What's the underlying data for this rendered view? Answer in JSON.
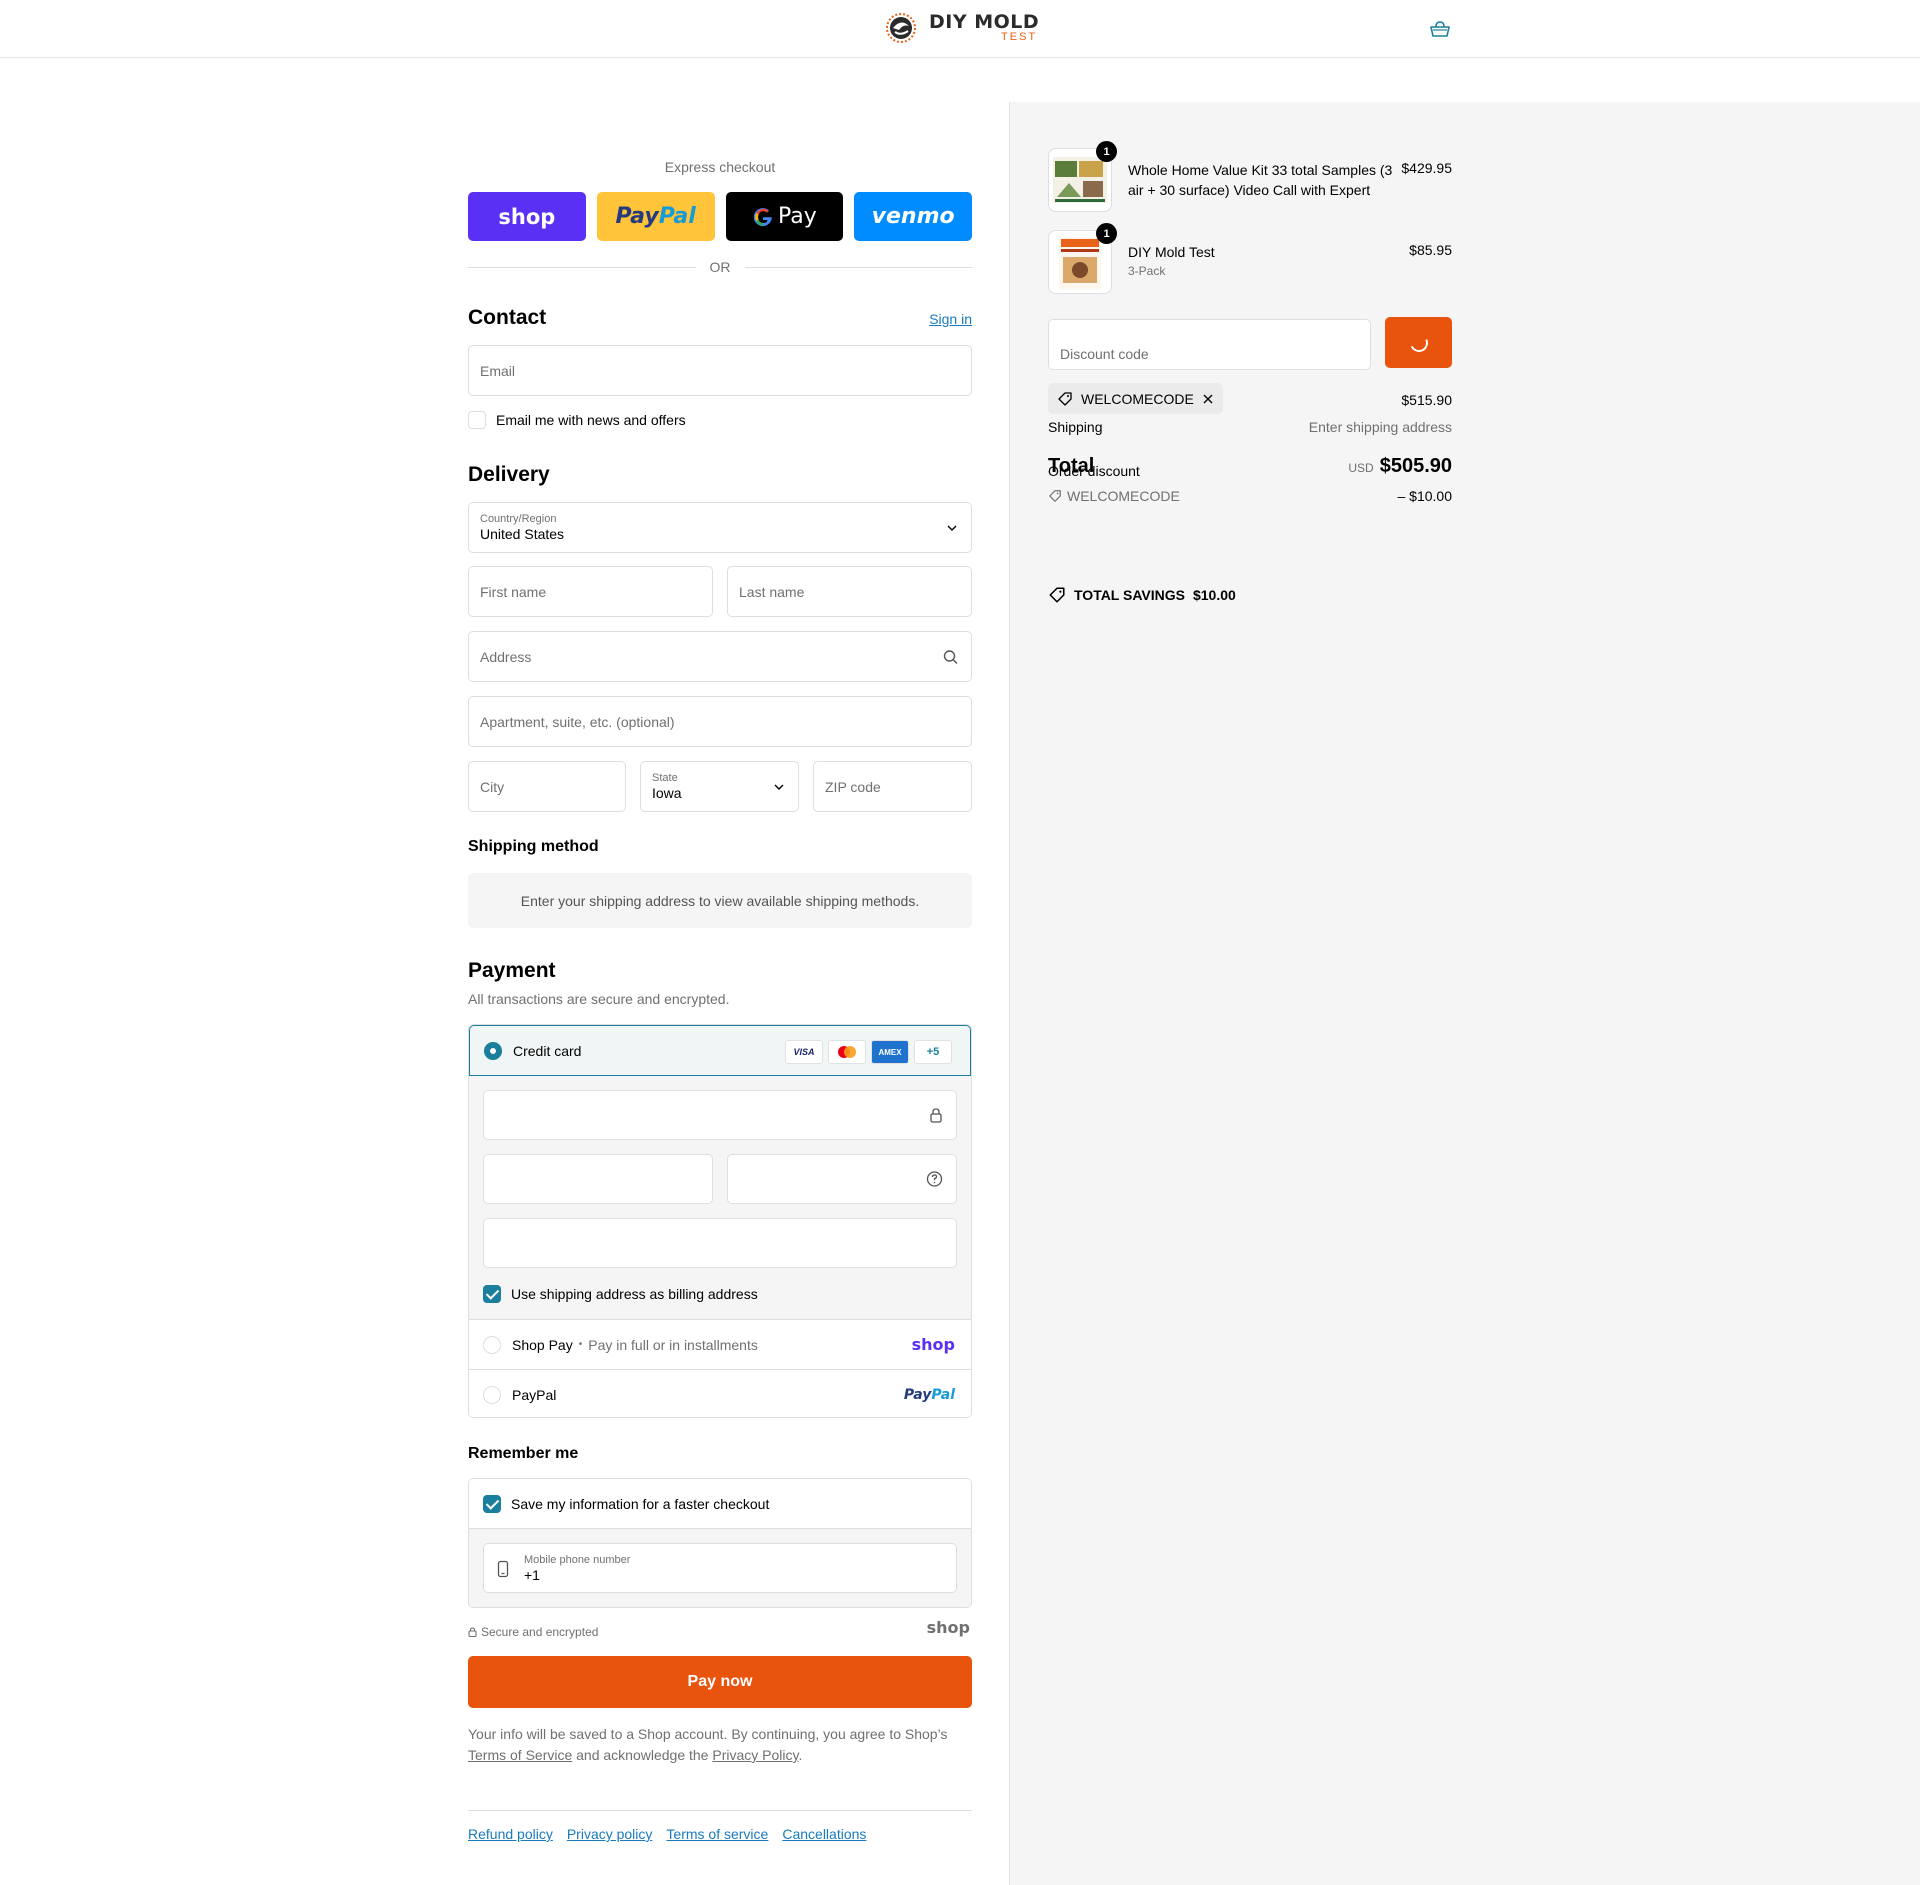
{
  "header": {
    "logo_line1": "DIY MOLD",
    "logo_line2": "TEST",
    "cart_icon": "bag-icon"
  },
  "express": {
    "title": "Express checkout",
    "shop_label": "shop",
    "paypal_label_a": "Pay",
    "paypal_label_b": "Pal",
    "gpay_label": "Pay",
    "venmo_label": "venmo",
    "or_label": "OR"
  },
  "contact": {
    "heading": "Contact",
    "sign_in": "Sign in",
    "email_placeholder": "Email",
    "newsletter_label": "Email me with news and offers"
  },
  "delivery": {
    "heading": "Delivery",
    "country_label": "Country/Region",
    "country_value": "United States",
    "first_name": "First name",
    "last_name": "Last name",
    "address": "Address",
    "apartment": "Apartment, suite, etc. (optional)",
    "city": "City",
    "state_label": "State",
    "state_value": "Iowa",
    "zip": "ZIP code"
  },
  "shipping_method": {
    "heading": "Shipping method",
    "message": "Enter your shipping address to view available shipping methods."
  },
  "payment": {
    "heading": "Payment",
    "subtitle": "All transactions are secure and encrypted.",
    "credit_card_label": "Credit card",
    "cards": [
      "VISA",
      "AMEX",
      "+5"
    ],
    "billing_same_label": "Use shipping address as billing address",
    "shop_pay_label": "Shop Pay",
    "shop_pay_sub": "Pay in full or in installments",
    "shop_pay_logo": "shop",
    "paypal_label": "PayPal",
    "paypal_logo_a": "Pay",
    "paypal_logo_b": "Pal",
    "accent_color": "#1a7f9c"
  },
  "remember": {
    "heading": "Remember me",
    "save_label": "Save my information for a faster checkout",
    "phone_label": "Mobile phone number",
    "phone_value": "+1",
    "secure_label": "Secure and encrypted",
    "shop_logo": "shop"
  },
  "pay_now": {
    "label": "Pay now",
    "color": "#e8540e"
  },
  "legal": {
    "text_a": "Your info will be saved to a Shop account. By continuing, you agree to Shop’s",
    "tos": "Terms of Service",
    "text_b": "and acknowledge the",
    "privacy": "Privacy Policy",
    "text_c": "."
  },
  "footer": {
    "links": [
      "Refund policy",
      "Privacy policy",
      "Terms of service",
      "Cancellations"
    ]
  },
  "order": {
    "items": [
      {
        "name": "Whole Home Value Kit 33 total Samples (3 air + 30 surface) Video Call with Expert",
        "price": "$429.95",
        "qty": "1",
        "variant": ""
      },
      {
        "name": "DIY Mold Test",
        "price": "$85.95",
        "qty": "1",
        "variant": "3-Pack"
      }
    ],
    "discount_placeholder": "Discount code",
    "applied_code": "WELCOMECODE",
    "subtotal_value": "$515.90",
    "shipping_label": "Shipping",
    "shipping_value": "Enter shipping address",
    "total_label": "Total",
    "order_discount_label": "Order discount",
    "currency": "USD",
    "total_value": "$505.90",
    "discount_code_line": "WELCOMECODE",
    "discount_value": "– $10.00",
    "savings_label": "TOTAL SAVINGS",
    "savings_value": "$10.00"
  }
}
